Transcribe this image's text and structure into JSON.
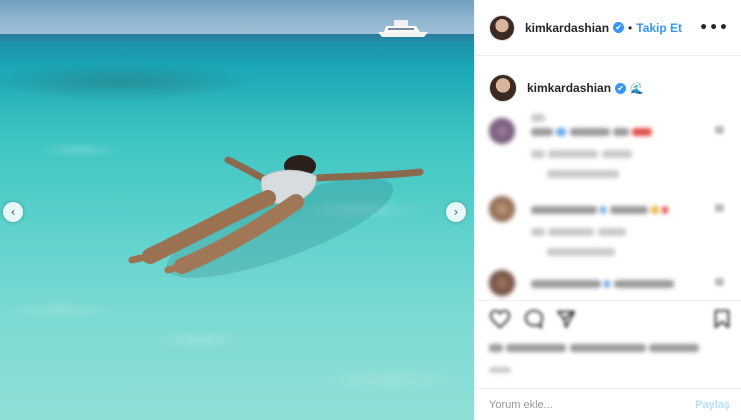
{
  "post": {
    "username": "kimkardashian",
    "verified_mark": "✔",
    "separator": "•",
    "follow_label": "Takip Et",
    "more_label": "•••"
  },
  "caption": {
    "username": "kimkardashian",
    "verified_mark": "✔",
    "emoji": "🌊"
  },
  "carousel": {
    "prev_glyph": "‹",
    "next_glyph": "›"
  },
  "comment_box": {
    "placeholder": "Yorum ekle...",
    "share_label": "Paylaş"
  },
  "colors": {
    "accent": "#3897f0",
    "share_disabled": "#b2dffc",
    "border": "#efefef"
  },
  "icons": [
    "more-icon",
    "verified-icon",
    "wave-icon",
    "heart-icon",
    "comment-icon",
    "share-icon",
    "bookmark-icon",
    "chevron-left-icon",
    "chevron-right-icon"
  ]
}
